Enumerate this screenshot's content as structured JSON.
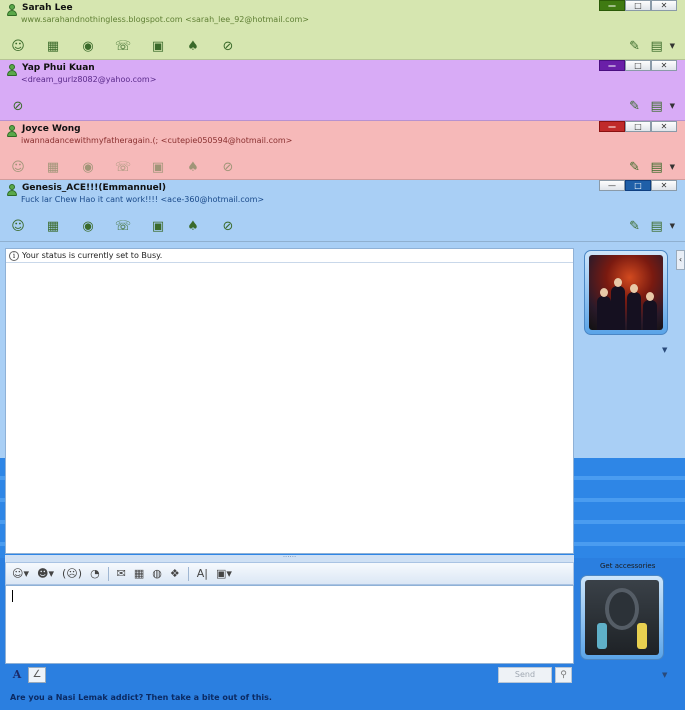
{
  "windows": [
    {
      "name": "Sarah Lee",
      "subtitle": "www.sarahandnothingless.blogspot.com <sarah_lee_92@hotmail.com>",
      "bg": "#d6e6b0",
      "accent": "#3f7a12",
      "subtitle_color": "#5f7f34"
    },
    {
      "name": "Yap Phui Kuan",
      "subtitle": "<dream_gurlz8082@yahoo.com>",
      "bg": "#d8abf6",
      "accent": "#6a1fa8",
      "subtitle_color": "#5a2a8a"
    },
    {
      "name": "Joyce Wong",
      "subtitle": "iwannadancewithmyfatheragain.(; <cutepie050594@hotmail.com>",
      "bg": "#f6b9b9",
      "accent": "#c02a2a",
      "subtitle_color": "#8a3030"
    },
    {
      "name": "Genesis_ACE!!!(Emmannuel)",
      "subtitle": "Fuck lar Chew Hao it cant work!!!! <ace-360@hotmail.com>",
      "bg": "#a9cff5",
      "accent": "#1f5fa8",
      "subtitle_color": "#1a4a8a"
    }
  ],
  "window_controls": {
    "minimize": "—",
    "restore": "□",
    "close": "✕"
  },
  "conversation": {
    "status_message": "Your status is currently set to Busy."
  },
  "compose": {
    "send_label": "Send"
  },
  "accessories": {
    "label": "Get accessories"
  },
  "ad": {
    "text": "Are you a Nasi Lemak addict? Then take a bite out of this."
  },
  "colors": {
    "main_bg": "#2b7fe0",
    "panel_light": "#a9cff5"
  }
}
